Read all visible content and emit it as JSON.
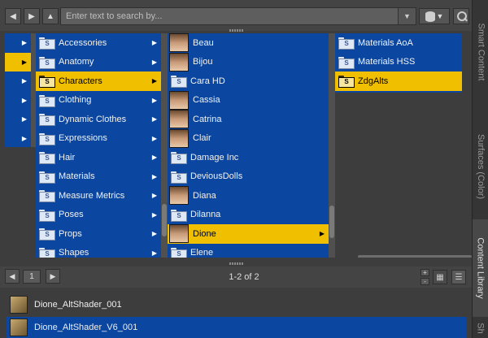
{
  "toolbar": {
    "back_icon": "arrow-left-icon",
    "forward_icon": "arrow-right-icon",
    "up_icon": "arrow-up-icon",
    "search_placeholder": "Enter text to search by...",
    "dropdown_icon": "chevron-down-icon",
    "database_icon": "database-icon",
    "search_icon": "search-icon"
  },
  "columns": {
    "col0": {
      "selected_index": 1,
      "rows": 6
    },
    "col1": {
      "items": [
        {
          "label": "Accessories"
        },
        {
          "label": "Anatomy"
        },
        {
          "label": "Characters",
          "selected": true
        },
        {
          "label": "Clothing"
        },
        {
          "label": "Dynamic Clothes"
        },
        {
          "label": "Expressions"
        },
        {
          "label": "Hair"
        },
        {
          "label": "Materials"
        },
        {
          "label": "Measure Metrics"
        },
        {
          "label": "Poses"
        },
        {
          "label": "Props"
        },
        {
          "label": "Shapes"
        }
      ]
    },
    "col2": {
      "items": [
        {
          "label": "Beau",
          "kind": "thumb"
        },
        {
          "label": "Bijou",
          "kind": "thumb"
        },
        {
          "label": "Cara HD",
          "kind": "folder"
        },
        {
          "label": "Cassia",
          "kind": "thumb"
        },
        {
          "label": "Catrina",
          "kind": "thumb"
        },
        {
          "label": "Clair",
          "kind": "thumb"
        },
        {
          "label": "Damage Inc",
          "kind": "folder"
        },
        {
          "label": "DeviousDolls",
          "kind": "folder"
        },
        {
          "label": "Diana",
          "kind": "thumb"
        },
        {
          "label": "Dilanna",
          "kind": "folder"
        },
        {
          "label": "Dione",
          "kind": "thumb",
          "selected": true
        },
        {
          "label": "Elene",
          "kind": "folder"
        }
      ]
    },
    "col3": {
      "items": [
        {
          "label": "Materials AoA"
        },
        {
          "label": "Materials HSS"
        },
        {
          "label": "ZdgAlts",
          "selected": true
        }
      ]
    }
  },
  "side_tabs": [
    {
      "label": "Smart Content",
      "active": false
    },
    {
      "label": "Surfaces (Color)",
      "active": false
    },
    {
      "label": "Content Library",
      "active": true
    },
    {
      "label": "Sh",
      "active": false
    }
  ],
  "pager": {
    "page_number": "1",
    "count_text": "1-2 of 2",
    "zoom_in": "+",
    "zoom_out": "-",
    "icon_view_icon": "grid-view-icon",
    "list_view_icon": "list-view-icon"
  },
  "results": [
    {
      "label": "Dione_AltShader_001",
      "selected": false
    },
    {
      "label": "Dione_AltShader_V6_001",
      "selected": true
    }
  ]
}
